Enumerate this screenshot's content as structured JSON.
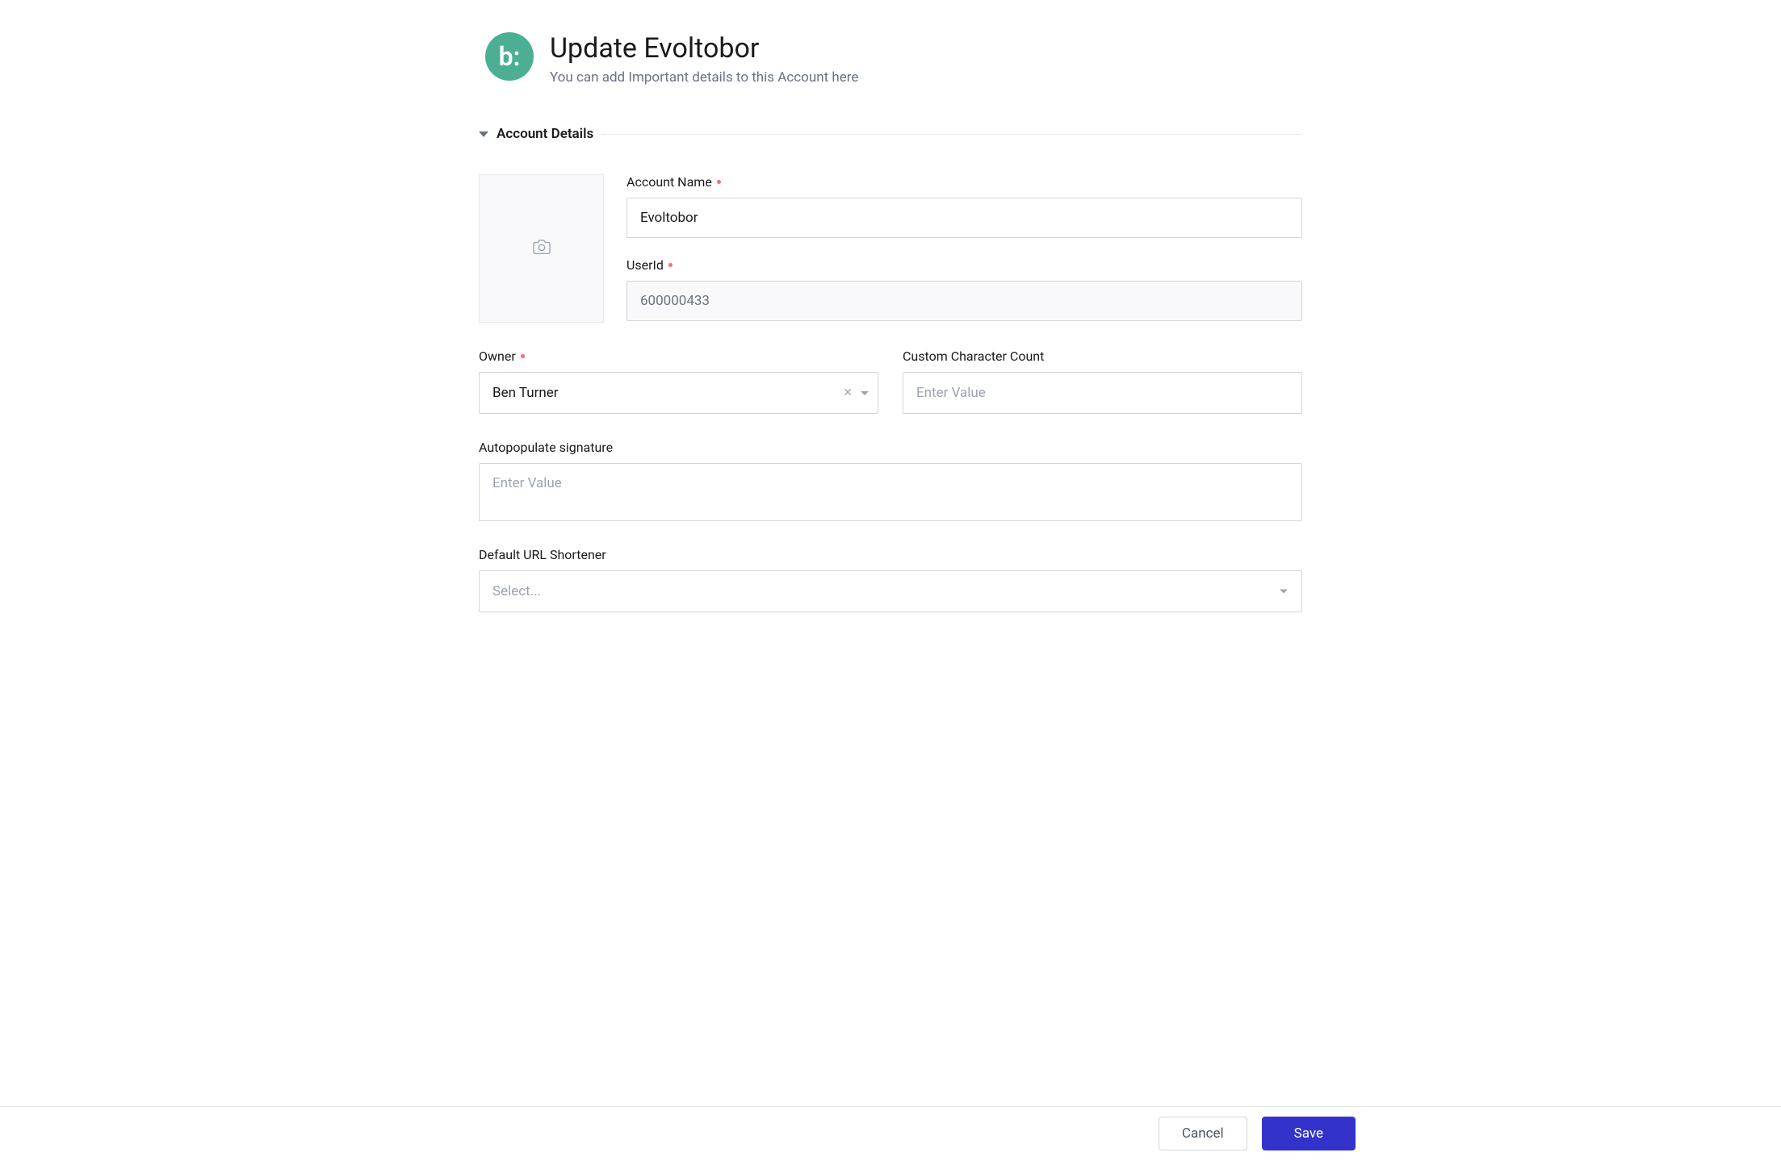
{
  "header": {
    "logo_text": "b:",
    "title": "Update Evoltobor",
    "subtitle": "You can add Important details to this Account here"
  },
  "section": {
    "title": "Account Details"
  },
  "fields": {
    "account_name": {
      "label": "Account Name",
      "value": "Evoltobor"
    },
    "user_id": {
      "label": "UserId",
      "value": "600000433"
    },
    "owner": {
      "label": "Owner",
      "value": "Ben Turner"
    },
    "char_count": {
      "label": "Custom Character Count",
      "placeholder": "Enter Value"
    },
    "signature": {
      "label": "Autopopulate signature",
      "placeholder": "Enter Value"
    },
    "url_shortener": {
      "label": "Default URL Shortener",
      "placeholder": "Select..."
    }
  },
  "footer": {
    "cancel": "Cancel",
    "save": "Save"
  }
}
